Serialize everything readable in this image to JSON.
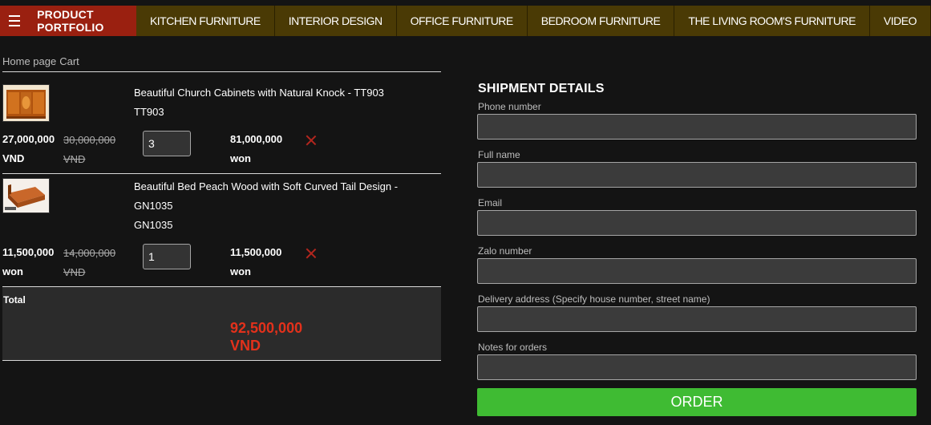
{
  "nav": {
    "portfolio_label": "PRODUCT PORTFOLIO",
    "items": [
      "KITCHEN FURNITURE",
      "INTERIOR DESIGN",
      "OFFICE FURNITURE",
      "BEDROOM FURNITURE",
      "THE LIVING ROOM'S FURNITURE",
      "VIDEO"
    ]
  },
  "breadcrumb": {
    "home": "Home page",
    "current": "Cart"
  },
  "cart": {
    "items": [
      {
        "title": "Beautiful Church Cabinets with Natural Knock - TT903",
        "code": "TT903",
        "price": "27,000,000",
        "price_unit": "VND",
        "old_price": "30,000,000",
        "old_price_unit": "VND",
        "quantity": "3",
        "line_total": "81,000,000",
        "line_total_unit": "won"
      },
      {
        "title": "Beautiful Bed Peach Wood with Soft Curved Tail Design -",
        "title2": "GN1035",
        "code": "GN1035",
        "price": "11,500,000",
        "price_unit": "won",
        "old_price": "14,000,000",
        "old_price_unit": "VND",
        "quantity": "1",
        "line_total": "11,500,000",
        "line_total_unit": "won"
      }
    ],
    "total_label": "Total",
    "total_value": "92,500,000",
    "total_unit": "VND"
  },
  "shipment": {
    "title": "SHIPMENT DETAILS",
    "fields": [
      {
        "label": "Phone number",
        "value": ""
      },
      {
        "label": "Full name",
        "value": ""
      },
      {
        "label": "Email",
        "value": ""
      },
      {
        "label": "Zalo number",
        "value": ""
      },
      {
        "label": "Delivery address (Specify house number, street name)",
        "value": ""
      },
      {
        "label": "Notes for orders",
        "value": ""
      }
    ],
    "order_button": "ORDER"
  },
  "colors": {
    "nav_bg": "#4a3a05",
    "portfolio_bg": "#9a2010",
    "total_red": "#e3311b",
    "order_green": "#3fbb33"
  }
}
